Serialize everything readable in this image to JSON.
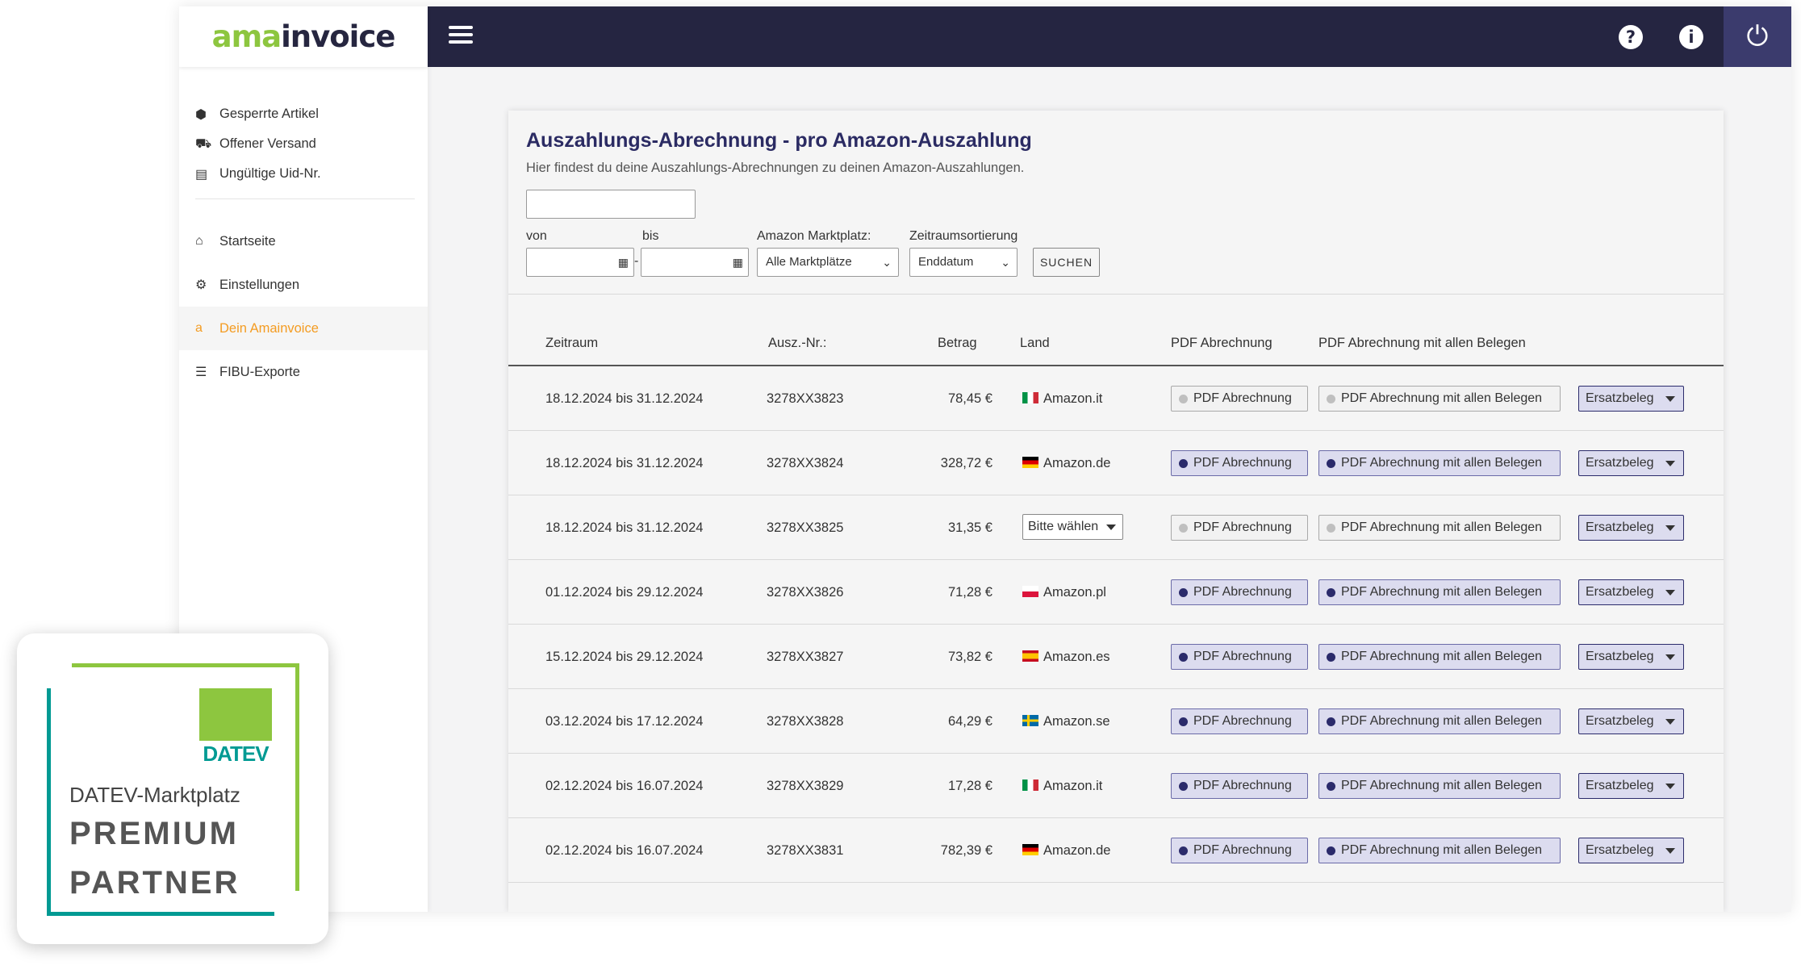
{
  "logo": {
    "part1": "ama",
    "part2": "invoice"
  },
  "sidebar": {
    "items_top": [
      {
        "label": "Gesperrte Artikel",
        "icon": "box-icon"
      },
      {
        "label": "Offener Versand",
        "icon": "truck-icon"
      },
      {
        "label": "Ungültige Uid-Nr.",
        "icon": "id-card-icon"
      }
    ],
    "items_main": [
      {
        "label": "Startseite",
        "icon": "home-icon"
      },
      {
        "label": "Einstellungen",
        "icon": "gears-icon"
      },
      {
        "label": "Dein Amainvoice",
        "icon": "amazon-icon",
        "active": true
      },
      {
        "label": "FIBU-Exporte",
        "icon": "list-icon"
      }
    ]
  },
  "topbar": {
    "help_icon": "question-icon",
    "info_icon": "info-icon",
    "power_icon": "power-icon"
  },
  "page": {
    "title": "Auszahlungs-Abrechnung - pro Amazon-Auszahlung",
    "subtitle": "Hier findest du deine Auszahlungs-Abrechnungen zu deinen Amazon-Auszahlungen."
  },
  "filters": {
    "von_label": "von",
    "bis_label": "bis",
    "dash": "-",
    "marketplace_label": "Amazon Marktplatz:",
    "marketplace_value": "Alle Marktplätze",
    "sort_label": "Zeitraumsortierung",
    "sort_value": "Enddatum",
    "search_button": "SUCHEN"
  },
  "table": {
    "headers": {
      "zeitraum": "Zeitraum",
      "ausz": "Ausz.-Nr.:",
      "betrag": "Betrag",
      "land": "Land",
      "pdf": "PDF Abrechnung",
      "pdf_all": "PDF Abrechnung mit allen Belegen"
    },
    "button_labels": {
      "pdf": "PDF Abrechnung",
      "pdf_all": "PDF Abrechnung mit allen Belegen",
      "ersatz": "Ersatzbeleg",
      "choose": "Bitte wählen"
    },
    "rows": [
      {
        "zeitraum": "18.12.2024 bis 31.12.2024",
        "ausz": "3278XX3823",
        "betrag": "78,45 €",
        "land": "Amazon.it",
        "flag": "it",
        "active": false
      },
      {
        "zeitraum": "18.12.2024 bis 31.12.2024",
        "ausz": "3278XX3824",
        "betrag": "328,72 €",
        "land": "Amazon.de",
        "flag": "de",
        "active": true
      },
      {
        "zeitraum": "18.12.2024 bis 31.12.2024",
        "ausz": "3278XX3825",
        "betrag": "31,35 €",
        "land": "",
        "flag": "",
        "active": false,
        "choose": true
      },
      {
        "zeitraum": "01.12.2024 bis 29.12.2024",
        "ausz": "3278XX3826",
        "betrag": "71,28 €",
        "land": "Amazon.pl",
        "flag": "pl",
        "active": true
      },
      {
        "zeitraum": "15.12.2024 bis 29.12.2024",
        "ausz": "3278XX3827",
        "betrag": "73,82 €",
        "land": "Amazon.es",
        "flag": "es",
        "active": true
      },
      {
        "zeitraum": "03.12.2024 bis 17.12.2024",
        "ausz": "3278XX3828",
        "betrag": "64,29 €",
        "land": "Amazon.se",
        "flag": "se",
        "active": true
      },
      {
        "zeitraum": "02.12.2024 bis 16.07.2024",
        "ausz": "3278XX3829",
        "betrag": "17,28 €",
        "land": "Amazon.it",
        "flag": "it",
        "active": true
      },
      {
        "zeitraum": "02.12.2024 bis 16.07.2024",
        "ausz": "3278XX3831",
        "betrag": "782,39 €",
        "land": "Amazon.de",
        "flag": "de",
        "active": true
      }
    ]
  },
  "badge": {
    "brand": "DATEV",
    "line1": "DATEV-Marktplatz",
    "line2": "PREMIUM",
    "line3": "PARTNER"
  },
  "colors": {
    "topbar": "#252541",
    "accent": "#2b2b63",
    "brand_green": "#8dc63f",
    "datev_teal": "#009a93",
    "active_nav": "#f49c22"
  }
}
